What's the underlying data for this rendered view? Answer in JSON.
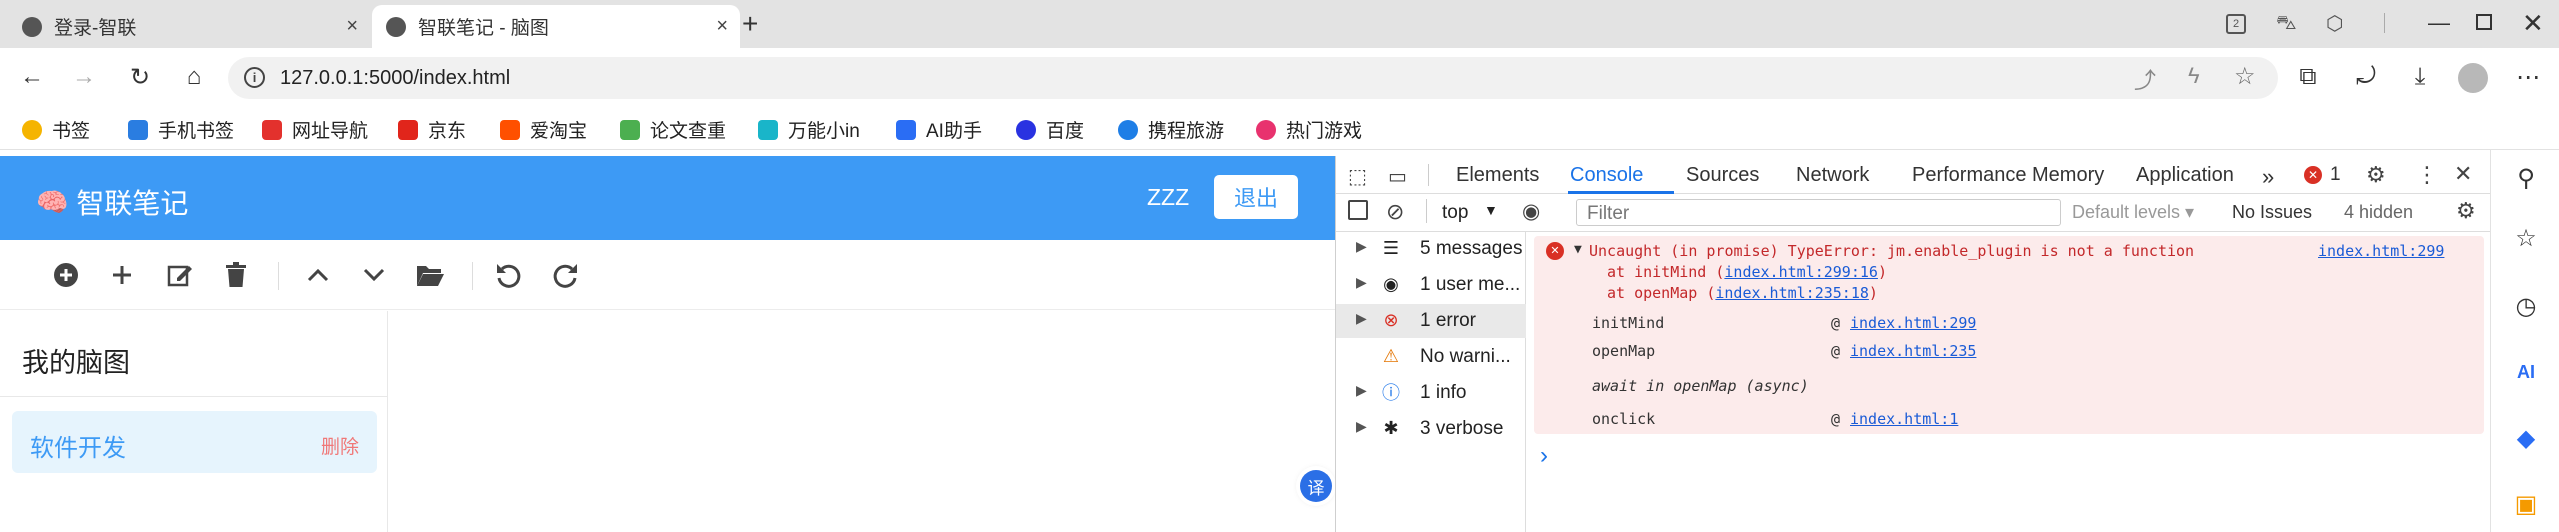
{
  "tabs": [
    {
      "title": "登录-智联",
      "close": "×"
    },
    {
      "title": "智联笔记 - 脑图",
      "close": "×"
    }
  ],
  "new_tab": "+",
  "address": {
    "url": "127.0.0.1:5000/index.html",
    "info": "i"
  },
  "bookmarks": [
    {
      "label": "书签",
      "color": "#f5b400"
    },
    {
      "label": "手机书签",
      "color": "#2a7de1"
    },
    {
      "label": "网址导航",
      "color": "#e3312d"
    },
    {
      "label": "京东",
      "color": "#e1251b"
    },
    {
      "label": "爱淘宝",
      "color": "#ff5000"
    },
    {
      "label": "论文查重",
      "color": "#4caf50"
    },
    {
      "label": "万能小in",
      "color": "#19b5c9"
    },
    {
      "label": "AI助手",
      "color": "#2a6df4"
    },
    {
      "label": "百度",
      "color": "#2932e1"
    },
    {
      "label": "携程旅游",
      "color": "#1e7ee6"
    },
    {
      "label": "热门游戏",
      "color": "#e8326e"
    }
  ],
  "app": {
    "logo_text": "智联笔记",
    "logo_icon": "🧠",
    "user": "ZZZ",
    "logout": "退出",
    "sidebar_title": "我的脑图",
    "map_name": "软件开发",
    "map_delete": "删除",
    "translate": "译"
  },
  "devtools": {
    "tabs": [
      "Elements",
      "Console",
      "Sources",
      "Network",
      "Performance",
      "Memory",
      "Application"
    ],
    "more": "»",
    "error_count": "1",
    "context": "top",
    "filter_placeholder": "Filter",
    "levels": "Default levels ▾",
    "issues": "No Issues",
    "hidden": "4 hidden",
    "sidebar": [
      {
        "label": "5 messages",
        "icon": "list-icon",
        "glyph": "☰"
      },
      {
        "label": "1 user me...",
        "icon": "user-icon",
        "glyph": "◉"
      },
      {
        "label": "1 error",
        "icon": "error-icon",
        "glyph": "⊗"
      },
      {
        "label": "No warni...",
        "icon": "warning-icon",
        "glyph": "⚠"
      },
      {
        "label": "1 info",
        "icon": "info-icon",
        "glyph": "ⓘ"
      },
      {
        "label": "3 verbose",
        "icon": "bug-icon",
        "glyph": "✱"
      }
    ],
    "error": {
      "main": "Uncaught (in promise) TypeError: jm.enable_plugin is not a function",
      "main_link": "index.html:299",
      "trace1_pre": "at initMind (",
      "trace1_link": "index.html:299:16",
      "trace2_pre": "at openMap (",
      "trace2_link": "index.html:235:18",
      "stack": [
        {
          "fn": "initMind",
          "at": "@",
          "link": "index.html:299"
        },
        {
          "fn": "openMap",
          "at": "@",
          "link": "index.html:235"
        },
        {
          "fn": "onclick",
          "at": "@",
          "link": "index.html:1"
        }
      ],
      "async_note": "await in openMap (async)"
    },
    "prompt": "›"
  }
}
